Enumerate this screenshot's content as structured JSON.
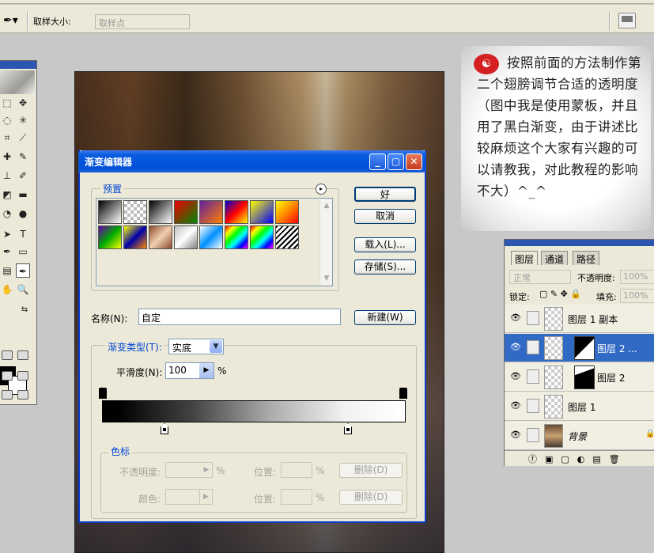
{
  "options_bar": {
    "sample_size_label": "取样大小:",
    "sample_size_value": "取样点"
  },
  "dialog": {
    "title": "渐变编辑器",
    "presets_label": "预置",
    "ok": "好",
    "cancel": "取消",
    "load": "载入(L)...",
    "save": "存储(S)...",
    "name_label": "名称(N):",
    "name_value": "自定",
    "new_button": "新建(W)",
    "gradient_type_label": "渐变类型(T):",
    "gradient_type_value": "实底",
    "smoothness_label": "平滑度(N):",
    "smoothness_value": "100",
    "percent": "%",
    "stops_label": "色标",
    "opacity_label": "不透明度:",
    "color_label": "颜色:",
    "location_label": "位置:",
    "delete_button": "删除(D)",
    "preset_swatches": [
      "linear-gradient(135deg,#000,#fff)",
      "repeating-conic-gradient(#bbb 0 25%,#fff 0 50%) 0 0/8px 8px",
      "linear-gradient(135deg,#000,#fff)",
      "linear-gradient(135deg,#e00,#080)",
      "linear-gradient(135deg,#6020a0,#ff8000)",
      "linear-gradient(135deg,#0000d0,#f00,#ff0)",
      "linear-gradient(135deg,#ff0,#00f)",
      "linear-gradient(135deg,#ff0,#f80,#f00)",
      "linear-gradient(135deg,#60a,#0a0,#ff0)",
      "linear-gradient(135deg,#ff0,#00a,#f80)",
      "linear-gradient(135deg,#8a4a2a,#f0d0b0,#8a4a2a)",
      "linear-gradient(135deg,#c0c0c0,#fff,#808080)",
      "linear-gradient(135deg,#fff,#0090ff,#fff)",
      "linear-gradient(135deg,#f00,#ff0,#0f0,#0ff,#00f,#f0f)",
      "linear-gradient(135deg,#f00,#ff0,#0f0,#0ff,#00f,#f0f)",
      "repeating-linear-gradient(135deg,#000 0 2px,#fff 2px 5px)"
    ]
  },
  "note": {
    "text": "按照前面的方法制作第二个翅膀调节合适的透明度（图中我是使用蒙板，并且用了黑白渐变，由于讲述比较麻烦这个大家有兴趣的可以请教我，对此教程的影响不大）^_^"
  },
  "layers_panel": {
    "tabs": [
      "图层",
      "通道",
      "路径"
    ],
    "blend_mode": "正常",
    "opacity_label": "不透明度:",
    "opacity_value": "100%",
    "lock_label": "锁定:",
    "fill_label": "填充:",
    "fill_value": "100%",
    "layers": [
      {
        "name": "图层 1 副本",
        "selected": false
      },
      {
        "name": "图层 2 ...",
        "selected": true
      },
      {
        "name": "图层 2",
        "selected": false
      },
      {
        "name": "图层 1",
        "selected": false
      },
      {
        "name": "背景",
        "selected": false
      }
    ]
  },
  "colors": {
    "titlebar": "#0050d8",
    "accent_label": "#0046d5",
    "layer_selected": "#316ac5"
  }
}
